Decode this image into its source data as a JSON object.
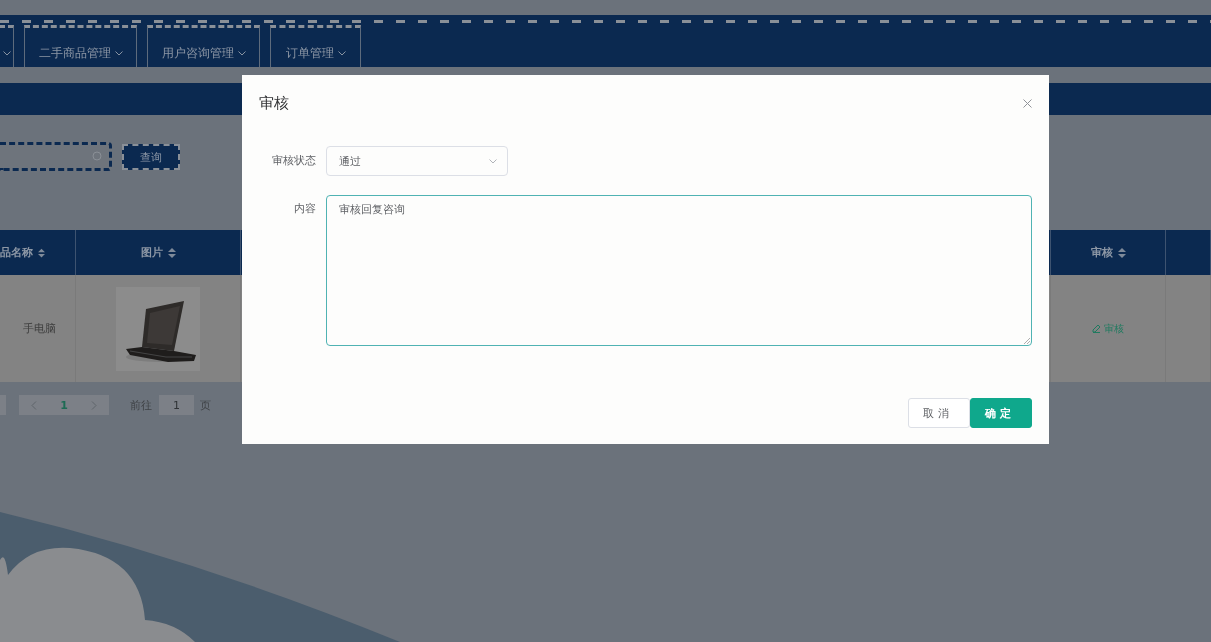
{
  "nav": {
    "items": [
      {
        "kind": "partial",
        "has_menu": true
      },
      {
        "kind": "item",
        "label": "二手商品管理",
        "has_menu": true
      },
      {
        "kind": "item",
        "label": "用户咨询管理",
        "has_menu": true
      },
      {
        "kind": "item",
        "label": "订单管理",
        "has_menu": true
      }
    ]
  },
  "search": {
    "button": "查询"
  },
  "table": {
    "columns": [
      {
        "label": "品名称",
        "sortable": true
      },
      {
        "label": "图片",
        "sortable": true
      },
      {
        "label": "审核",
        "sortable": true
      }
    ],
    "rows": [
      {
        "name": "手电脑",
        "action": "审核"
      }
    ]
  },
  "pagination": {
    "current_page": "1",
    "goto_label": "前往",
    "goto_value": "1",
    "goto_unit": "页"
  },
  "dialog": {
    "title": "审核",
    "fields": [
      {
        "kind": "select",
        "label": "审核状态",
        "value": "通过"
      },
      {
        "kind": "textarea",
        "label": "内容",
        "value": "审核回复咨询",
        "focused": true
      }
    ],
    "buttons": [
      {
        "label": "取消",
        "kind": "default"
      },
      {
        "label": "确定",
        "kind": "primary"
      }
    ]
  }
}
